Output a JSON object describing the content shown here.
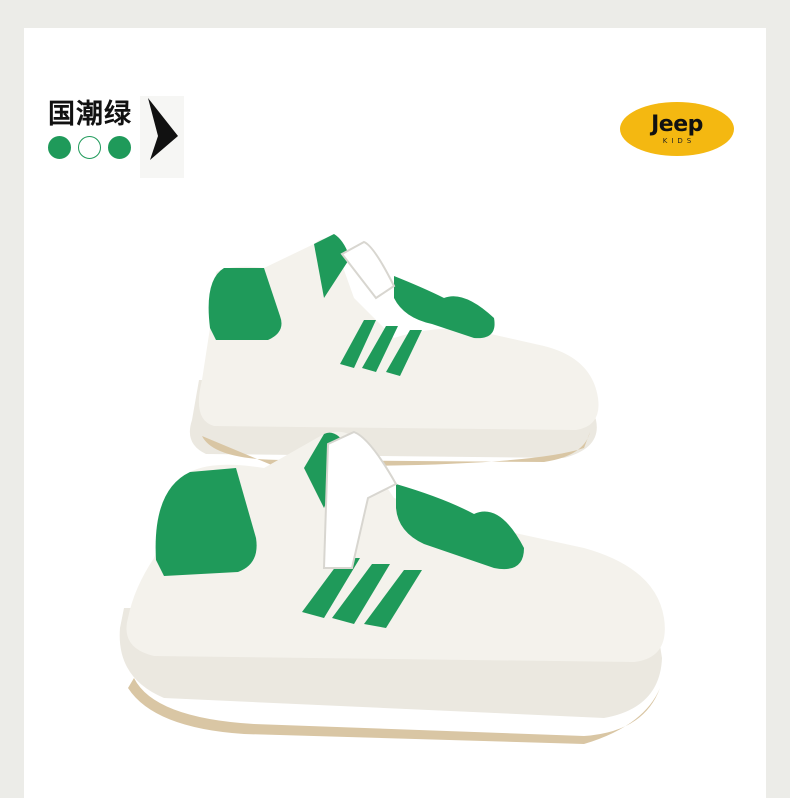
{
  "product": {
    "color_name": "国潮绿",
    "swatches": [
      {
        "name": "green-swatch",
        "color": "#1f9a5a"
      },
      {
        "name": "white-swatch",
        "color": "#ffffff"
      },
      {
        "name": "green-swatch-2",
        "color": "#1f9a5a"
      }
    ]
  },
  "brand": {
    "logo_text": "Jeep",
    "logo_sub": "KIDS",
    "logo_color": "#f4b811"
  },
  "colors": {
    "accent": "#1f9a5a",
    "shoe_white": "#f4f2ec",
    "sole_tan": "#d9c6a4"
  }
}
